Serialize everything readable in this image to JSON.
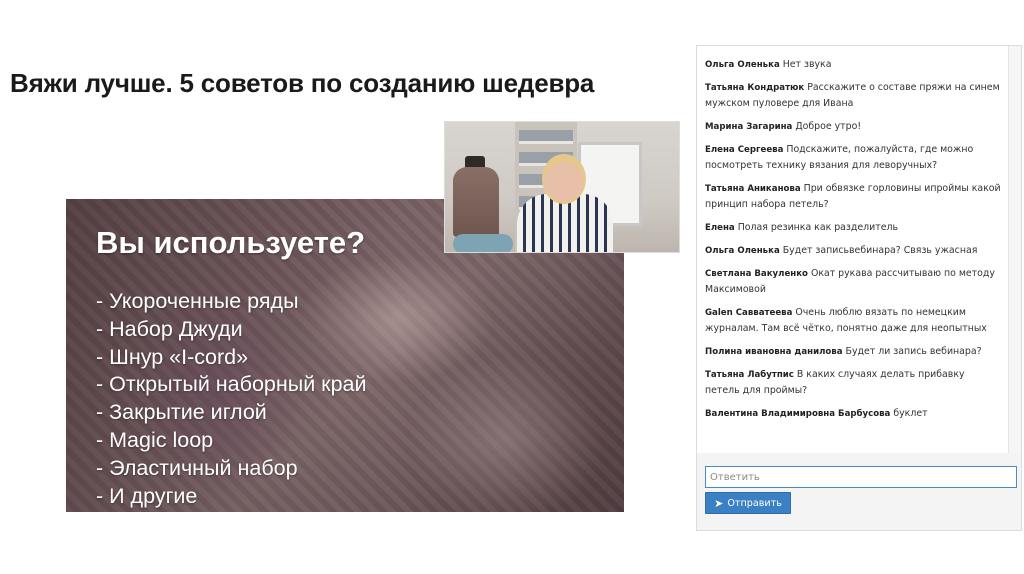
{
  "page": {
    "title": "Вяжи лучше. 5 советов по созданию шедевра"
  },
  "slide": {
    "heading": "Вы используете?",
    "items": [
      "- Укороченные ряды",
      "- Набор Джуди",
      "- Шнур «I-cord»",
      "- Открытый наборный край",
      "- Закрытие иглой",
      "- Magic loop",
      "- Эластичный набор",
      "- И другие"
    ]
  },
  "chat": {
    "messages": [
      {
        "author": "Ольга Оленька",
        "text": "Нет звука"
      },
      {
        "author": "Татьяна Кондратюк",
        "text": "Расскажите о составе пряжи на синем мужском пуловере для Ивана"
      },
      {
        "author": "Марина Загарина",
        "text": "Доброе утро!"
      },
      {
        "author": "Елена Сергеева",
        "text": "Подскажите, пожалуйста, где можно посмотреть технику вязания для леворучных?"
      },
      {
        "author": "Татьяна Аниканова",
        "text": "При обвязке горловины ипроймы какой принцип набора петель?"
      },
      {
        "author": "Елена",
        "text": "Полая резинка как разделитель"
      },
      {
        "author": "Ольга Оленька",
        "text": "Будет записьвебинара? Связь ужасная"
      },
      {
        "author": "Светлана Вакуленко",
        "text": "Окат рукава рассчитываю по методу Максимовой"
      },
      {
        "author": "Galen Савватеева",
        "text": "Очень люблю вязать по немецким журналам. Там всё чётко, понятно даже для неопытных"
      },
      {
        "author": "Полина ивановна данилова",
        "text": "Будет ли запись вебинара?"
      },
      {
        "author": "Татьяна Лабутпис",
        "text": "В каких случаях делать прибавку петель для проймы?"
      },
      {
        "author": "Валентина Владимировна Барбусова",
        "text": "буклет"
      }
    ],
    "input_placeholder": "Ответить",
    "send_label": "Отправить",
    "send_icon": "paper-plane-icon"
  },
  "colors": {
    "accent": "#3b7fc4",
    "input_border": "#4a89c4"
  }
}
